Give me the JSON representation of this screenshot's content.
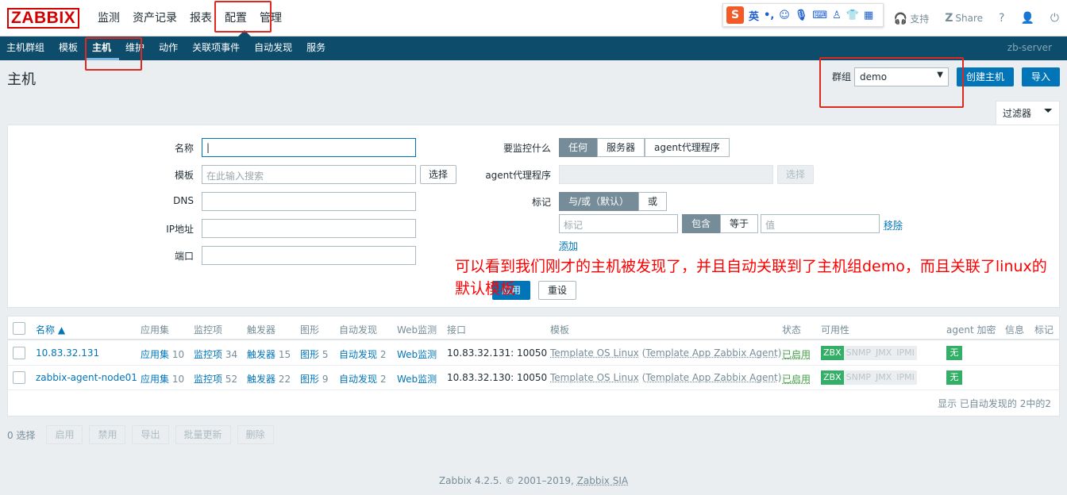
{
  "logo": "ZABBIX",
  "top_menu": [
    "监测",
    "资产记录",
    "报表",
    "配置",
    "管理"
  ],
  "ime_bar": {
    "logo": "S",
    "lang": "英",
    "punct": "•,",
    "icons": [
      "emoji-icon",
      "mic-icon",
      "keyboard-icon",
      "user-icon",
      "shirt-icon",
      "grid-icon"
    ]
  },
  "top_links": {
    "support": "支持",
    "share": "Share",
    "help": "?",
    "user": "",
    "logout": ""
  },
  "sub_menu": [
    "主机群组",
    "模板",
    "主机",
    "维护",
    "动作",
    "关联项事件",
    "自动发现",
    "服务"
  ],
  "server_name": "zb-server",
  "page_title": "主机",
  "group_label": "群组",
  "group_value": "demo",
  "create_button": "创建主机",
  "import_button": "导入",
  "filter_tab": "过滤器",
  "filter": {
    "name_label": "名称",
    "name_value": "|",
    "template_label": "模板",
    "template_placeholder": "在此输入搜索",
    "select_label": "选择",
    "dns_label": "DNS",
    "ip_label": "IP地址",
    "port_label": "端口",
    "monitor_label": "要监控什么",
    "monitor_options": [
      "任何",
      "服务器",
      "agent代理程序"
    ],
    "proxy_label": "agent代理程序",
    "proxy_select": "选择",
    "tags_label": "标记",
    "tag_mode_options": [
      "与/或（默认）",
      "或"
    ],
    "tag_placeholder": "标记",
    "tag_op_options": [
      "包含",
      "等于"
    ],
    "value_placeholder": "值",
    "remove_label": "移除",
    "add_label": "添加",
    "apply_label": "应用",
    "reset_label": "重设"
  },
  "annotation": "可以看到我们刚才的主机被发现了，并且自动关联到了主机组demo，而且关联了linux的默认模板",
  "table": {
    "headers": [
      "名称 ▲",
      "应用集",
      "监控项",
      "触发器",
      "图形",
      "自动发现",
      "Web监测",
      "接口",
      "模板",
      "状态",
      "可用性",
      "agent 加密",
      "信息",
      "标记"
    ],
    "rows": [
      {
        "name": "10.83.32.131",
        "apps": "应用集",
        "apps_n": "10",
        "items": "监控项",
        "items_n": "34",
        "triggers": "触发器",
        "triggers_n": "15",
        "graphs": "图形",
        "graphs_n": "5",
        "discovery": "自动发现",
        "discovery_n": "2",
        "web": "Web监测",
        "interface": "10.83.32.131: 10050",
        "template": "Template OS Linux",
        "template2": "Template App Zabbix Agent",
        "status": "已启用",
        "avail": [
          "ZBX",
          "SNMP",
          "JMX",
          "IPMI"
        ],
        "enc": "无"
      },
      {
        "name": "zabbix-agent-node01",
        "apps": "应用集",
        "apps_n": "10",
        "items": "监控项",
        "items_n": "52",
        "triggers": "触发器",
        "triggers_n": "22",
        "graphs": "图形",
        "graphs_n": "9",
        "discovery": "自动发现",
        "discovery_n": "2",
        "web": "Web监测",
        "interface": "10.83.32.130: 10050",
        "template": "Template OS Linux",
        "template2": "Template App Zabbix Agent",
        "status": "已启用",
        "avail": [
          "ZBX",
          "SNMP",
          "JMX",
          "IPMI"
        ],
        "enc": "无"
      }
    ],
    "summary": "显示 已自动发现的 2中的2"
  },
  "bottom": {
    "selected": "0 选择",
    "buttons": [
      "启用",
      "禁用",
      "导出",
      "批量更新",
      "删除"
    ]
  },
  "footer": {
    "text": "Zabbix 4.2.5. © 2001–2019, ",
    "link": "Zabbix SIA"
  }
}
